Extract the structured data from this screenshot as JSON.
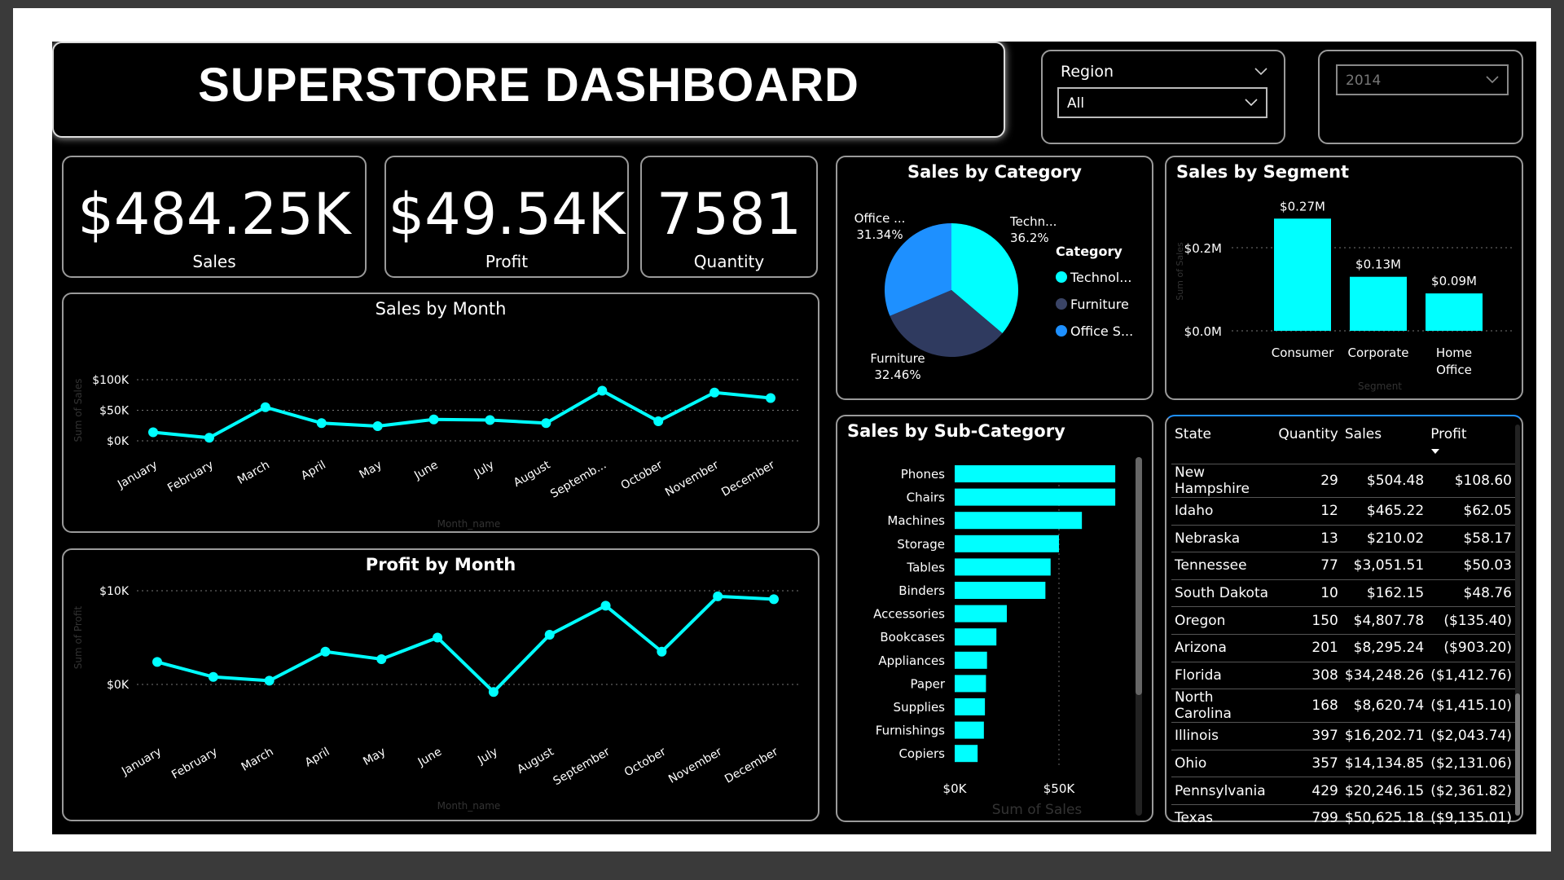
{
  "header": {
    "title": "SUPERSTORE DASHBOARD"
  },
  "filters": {
    "region": {
      "label": "Region",
      "value": "All"
    },
    "year": {
      "value": "2014"
    }
  },
  "kpis": [
    {
      "value": "$484.25K",
      "label": "Sales"
    },
    {
      "value": "$49.54K",
      "label": "Profit"
    },
    {
      "value": "7581",
      "label": "Quantity"
    }
  ],
  "colors": {
    "accent": "#00ffff",
    "bar": "#1affff",
    "office": "#1e90ff",
    "furniture": "#2f3a5f",
    "panel_border": "#9a9a9a"
  },
  "chart_data": [
    {
      "id": "sales_by_month",
      "type": "line",
      "title": "Sales by Month",
      "xlabel": "Month_name",
      "ylabel": "Sum of Sales",
      "categories": [
        "January",
        "February",
        "March",
        "April",
        "May",
        "June",
        "July",
        "August",
        "Septemb...",
        "October",
        "November",
        "December"
      ],
      "values": [
        14000,
        5000,
        55000,
        29000,
        24000,
        35000,
        34000,
        29000,
        82000,
        32000,
        79000,
        70000
      ],
      "yticks": [
        "$0K",
        "$50K",
        "$100K"
      ],
      "ylim": [
        0,
        100000
      ],
      "grid": true
    },
    {
      "id": "profit_by_month",
      "type": "line",
      "title": "Profit by Month",
      "xlabel": "Month_name",
      "ylabel": "Sum of Profit",
      "categories": [
        "January",
        "February",
        "March",
        "April",
        "May",
        "June",
        "July",
        "August",
        "September",
        "October",
        "November",
        "December"
      ],
      "values": [
        2400,
        800,
        400,
        3500,
        2700,
        5000,
        -800,
        5300,
        8400,
        3500,
        9400,
        9100
      ],
      "yticks": [
        "$0K",
        "$10K"
      ],
      "ylim": [
        0,
        10000
      ],
      "grid": true
    },
    {
      "id": "sales_by_category",
      "type": "pie",
      "title": "Sales by Category",
      "legend_title": "Category",
      "legend_position": "right",
      "slices": [
        {
          "name": "Technol...",
          "callout": "Techn...",
          "percent_label": "36.2%",
          "value": 36.2,
          "color": "#00ffff"
        },
        {
          "name": "Furniture",
          "callout": "Furniture",
          "percent_label": "32.46%",
          "value": 32.46,
          "color": "#2f3a5f"
        },
        {
          "name": "Office S...",
          "callout": "Office ...",
          "percent_label": "31.34%",
          "value": 31.34,
          "color": "#1e90ff"
        }
      ]
    },
    {
      "id": "sales_by_segment",
      "type": "bar",
      "title": "Sales by Segment",
      "xlabel": "Segment",
      "ylabel": "Sum of Sales",
      "categories": [
        "Consumer",
        "Corporate",
        "Home Office"
      ],
      "values": [
        0.27,
        0.13,
        0.09
      ],
      "data_labels": [
        "$0.27M",
        "$0.13M",
        "$0.09M"
      ],
      "yticks": [
        "$0.0M",
        "$0.2M"
      ],
      "ylim": [
        0,
        0.3
      ]
    },
    {
      "id": "sales_by_subcategory",
      "type": "bar",
      "orientation": "horizontal",
      "title": "Sales by Sub-Category",
      "xlabel": "Sum of Sales",
      "categories": [
        "Phones",
        "Chairs",
        "Machines",
        "Storage",
        "Tables",
        "Binders",
        "Accessories",
        "Bookcases",
        "Appliances",
        "Paper",
        "Supplies",
        "Furnishings",
        "Copiers"
      ],
      "values": [
        77000,
        77000,
        61000,
        50000,
        46000,
        43500,
        25000,
        20000,
        15500,
        15000,
        14500,
        14000,
        11000
      ],
      "xticks": [
        "$0K",
        "$50K"
      ],
      "xlim": [
        0,
        80000
      ]
    },
    {
      "id": "state_table",
      "type": "table",
      "columns": [
        "State",
        "Quantity",
        "Sales",
        "Profit"
      ],
      "sort": {
        "column": "Profit",
        "direction": "desc"
      },
      "rows": [
        [
          "New Hampshire",
          "29",
          "$504.48",
          "$108.60"
        ],
        [
          "Idaho",
          "12",
          "$465.22",
          "$62.05"
        ],
        [
          "Nebraska",
          "13",
          "$210.02",
          "$58.17"
        ],
        [
          "Tennessee",
          "77",
          "$3,051.51",
          "$50.03"
        ],
        [
          "South Dakota",
          "10",
          "$162.15",
          "$48.76"
        ],
        [
          "Oregon",
          "150",
          "$4,807.78",
          "($135.40)"
        ],
        [
          "Arizona",
          "201",
          "$8,295.24",
          "($903.20)"
        ],
        [
          "Florida",
          "308",
          "$34,248.26",
          "($1,412.76)"
        ],
        [
          "North Carolina",
          "168",
          "$8,620.74",
          "($1,415.10)"
        ],
        [
          "Illinois",
          "397",
          "$16,202.71",
          "($2,043.74)"
        ],
        [
          "Ohio",
          "357",
          "$14,134.85",
          "($2,131.06)"
        ],
        [
          "Pennsylvania",
          "429",
          "$20,246.15",
          "($2,361.82)"
        ],
        [
          "Texas",
          "799",
          "$50,625.18",
          "($9,135.01)"
        ]
      ]
    }
  ]
}
